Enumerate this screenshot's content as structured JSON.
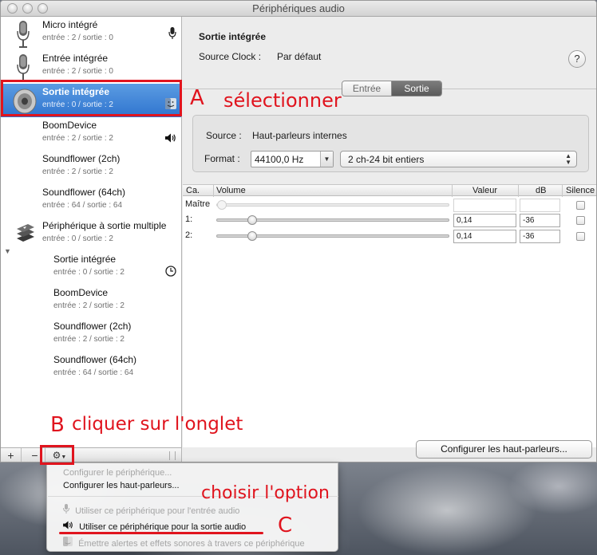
{
  "window": {
    "title": "Périphériques audio"
  },
  "sidebar": {
    "devices": [
      {
        "name": "Micro intégré",
        "channels": "entrée : 2 / sortie : 0",
        "icon": "microphone-icon",
        "right_icon": "microphone-icon"
      },
      {
        "name": "Entrée intégrée",
        "channels": "entrée : 2 / sortie : 0",
        "icon": "microphone-icon"
      },
      {
        "name": "Sortie intégrée",
        "channels": "entrée : 0 / sortie : 2",
        "icon": "speaker-icon",
        "right_icon": "finder-icon",
        "selected": true
      },
      {
        "name": "BoomDevice",
        "channels": "entrée : 2 / sortie : 2",
        "right_icon": "speaker-volume-icon"
      },
      {
        "name": "Soundflower (2ch)",
        "channels": "entrée : 2 / sortie : 2"
      },
      {
        "name": "Soundflower (64ch)",
        "channels": "entrée : 64 / sortie : 64"
      },
      {
        "name": "Périphérique à sortie multiple",
        "channels": "entrée : 0 / sortie : 2",
        "icon": "multi-output-icon",
        "expanded": true
      }
    ],
    "children": [
      {
        "name": "Sortie intégrée",
        "channels": "entrée : 0 / sortie : 2",
        "right_icon": "clock-icon"
      },
      {
        "name": "BoomDevice",
        "channels": "entrée : 2 / sortie : 2"
      },
      {
        "name": "Soundflower (2ch)",
        "channels": "entrée : 2 / sortie : 2"
      },
      {
        "name": "Soundflower (64ch)",
        "channels": "entrée : 64 / sortie : 64"
      }
    ],
    "toolbar": {
      "add": "+",
      "remove": "−"
    }
  },
  "detail": {
    "device_title": "Sortie intégrée",
    "clock_label": "Source Clock :",
    "clock_value": "Par défaut",
    "help": "?",
    "tabs": [
      {
        "label": "Entrée",
        "active": false
      },
      {
        "label": "Sortie",
        "active": true
      }
    ],
    "source_label": "Source :",
    "source_value": "Haut-parleurs internes",
    "format_label": "Format :",
    "sample_rate": "44100,0 Hz",
    "format_value": "2 ch-24 bit entiers"
  },
  "volume_table": {
    "headers": {
      "channel": "Ca.",
      "volume": "Volume",
      "value": "Valeur",
      "db": "dB",
      "mute": "Silence"
    },
    "rows": [
      {
        "channel": "Maître",
        "value": "",
        "db": "",
        "level": 0.0,
        "enabled": false
      },
      {
        "channel": "1:",
        "value": "0,14",
        "db": "-36",
        "level": 0.14,
        "enabled": true
      },
      {
        "channel": "2:",
        "value": "0,14",
        "db": "-36",
        "level": 0.14,
        "enabled": true
      }
    ]
  },
  "configure_button": "Configurer les haut-parleurs...",
  "menu": {
    "items": [
      {
        "label": "Configurer le périphérique...",
        "enabled": false
      },
      {
        "label": "Configurer les haut-parleurs...",
        "enabled": true
      },
      {
        "label": "Utiliser ce périphérique pour l'entrée audio",
        "enabled": false,
        "icon": "microphone-icon"
      },
      {
        "label": "Utiliser ce périphérique pour la sortie audio",
        "enabled": true,
        "icon": "speaker-volume-icon"
      },
      {
        "label": "Émettre alertes et effets sonores à travers ce périphérique",
        "enabled": false,
        "icon": "finder-icon"
      }
    ]
  },
  "annotations": {
    "a_letter": "A",
    "a_text": "sélectionner",
    "b_letter": "B",
    "b_text": "cliquer sur l'onglet",
    "c_text": "choisir l'option",
    "c_letter": "C",
    "color": "#e0141e"
  },
  "colors": {
    "selection": "#3d82d6",
    "accent_red": "#e0141e"
  }
}
